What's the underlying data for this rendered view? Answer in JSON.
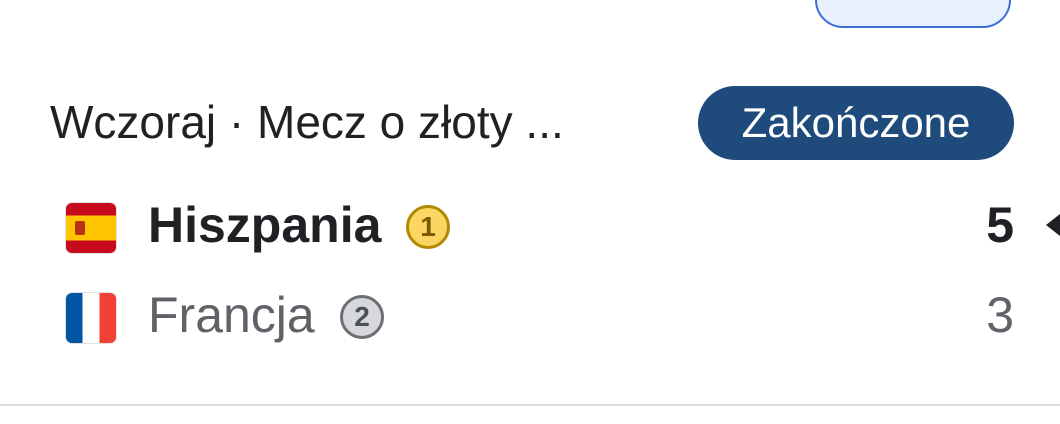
{
  "match": {
    "header": "Wczoraj · Mecz o złoty ...",
    "status": "Zakończone"
  },
  "teams": [
    {
      "name": "Hiszpania",
      "rank": "1",
      "score": "5",
      "flag_icon": "spain-flag-icon",
      "rank_color": "#fcd663",
      "winner": true
    },
    {
      "name": "Francja",
      "rank": "2",
      "score": "3",
      "flag_icon": "france-flag-icon",
      "rank_color": "#d7d8db",
      "winner": false
    }
  ],
  "colors": {
    "status_badge": "#1f4a7c",
    "chip_border": "#3b6fd4",
    "chip_fill": "#e8f0fe"
  }
}
